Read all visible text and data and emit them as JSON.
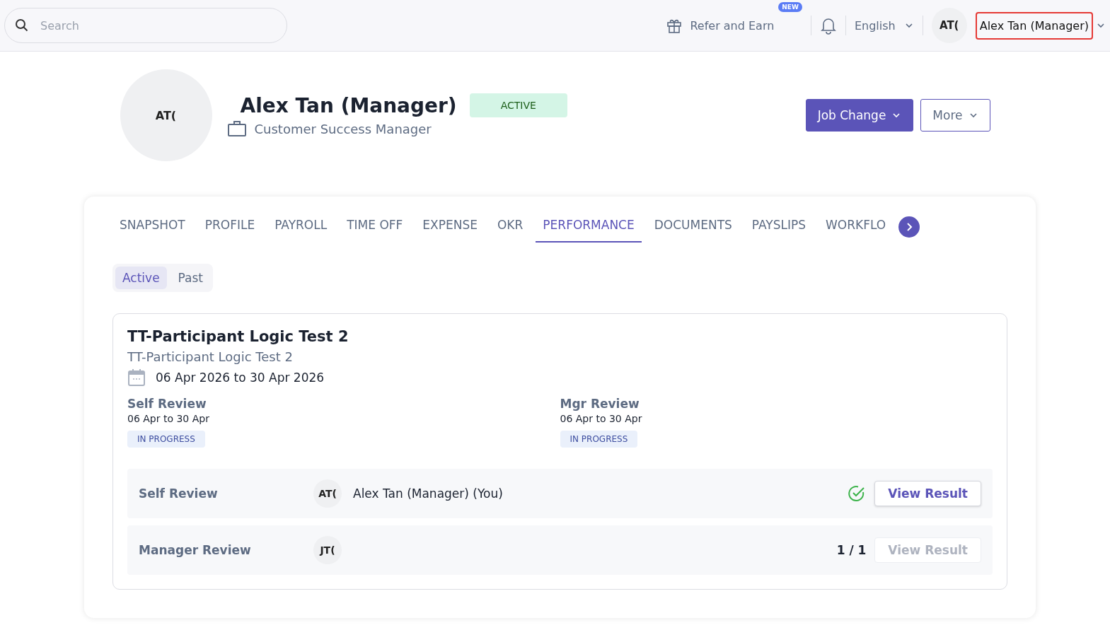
{
  "topbar": {
    "search": {
      "placeholder": "Search"
    },
    "refer": {
      "label": "Refer and Earn",
      "badge": "NEW"
    },
    "language": "English",
    "user": {
      "initials": "AT(",
      "name": "Alex Tan (Manager)",
      "highlighted": true
    }
  },
  "profile": {
    "initials": "AT(",
    "name": "Alex Tan (Manager)",
    "status": "ACTIVE",
    "title": "Customer Success Manager",
    "buttons": [
      {
        "label": "Job Change",
        "kind": "primary"
      },
      {
        "label": "More",
        "kind": "outline"
      }
    ]
  },
  "tabs": [
    {
      "label": "SNAPSHOT",
      "selected": false
    },
    {
      "label": "PROFILE",
      "selected": false
    },
    {
      "label": "PAYROLL",
      "selected": false
    },
    {
      "label": "TIME OFF",
      "selected": false
    },
    {
      "label": "EXPENSE",
      "selected": false
    },
    {
      "label": "OKR",
      "selected": false
    },
    {
      "label": "PERFORMANCE",
      "selected": true
    },
    {
      "label": "DOCUMENTS",
      "selected": false
    },
    {
      "label": "PAYSLIPS",
      "selected": false
    },
    {
      "label": "WORKFLO",
      "selected": false
    }
  ],
  "subtabs": [
    {
      "label": "Active",
      "selected": true
    },
    {
      "label": "Past",
      "selected": false
    }
  ],
  "review": {
    "title": "TT-Participant Logic Test 2",
    "subtitle": "TT-Participant Logic Test 2",
    "dates": "06 Apr 2026 to 30 Apr 2026",
    "phases": [
      {
        "name": "Self Review",
        "dates": "06 Apr to 30 Apr",
        "status": "IN PROGRESS"
      },
      {
        "name": "Mgr Review",
        "dates": "06 Apr to 30 Apr",
        "status": "IN PROGRESS"
      }
    ],
    "rows": [
      {
        "label": "Self Review",
        "initials": "AT(",
        "person": "Alex Tan (Manager) (You)",
        "done": true,
        "button": "View Result",
        "disabled": false
      },
      {
        "label": "Manager Review",
        "initials": "JT(",
        "count": "1 / 1",
        "done": false,
        "button": "View Result",
        "disabled": true
      }
    ]
  }
}
